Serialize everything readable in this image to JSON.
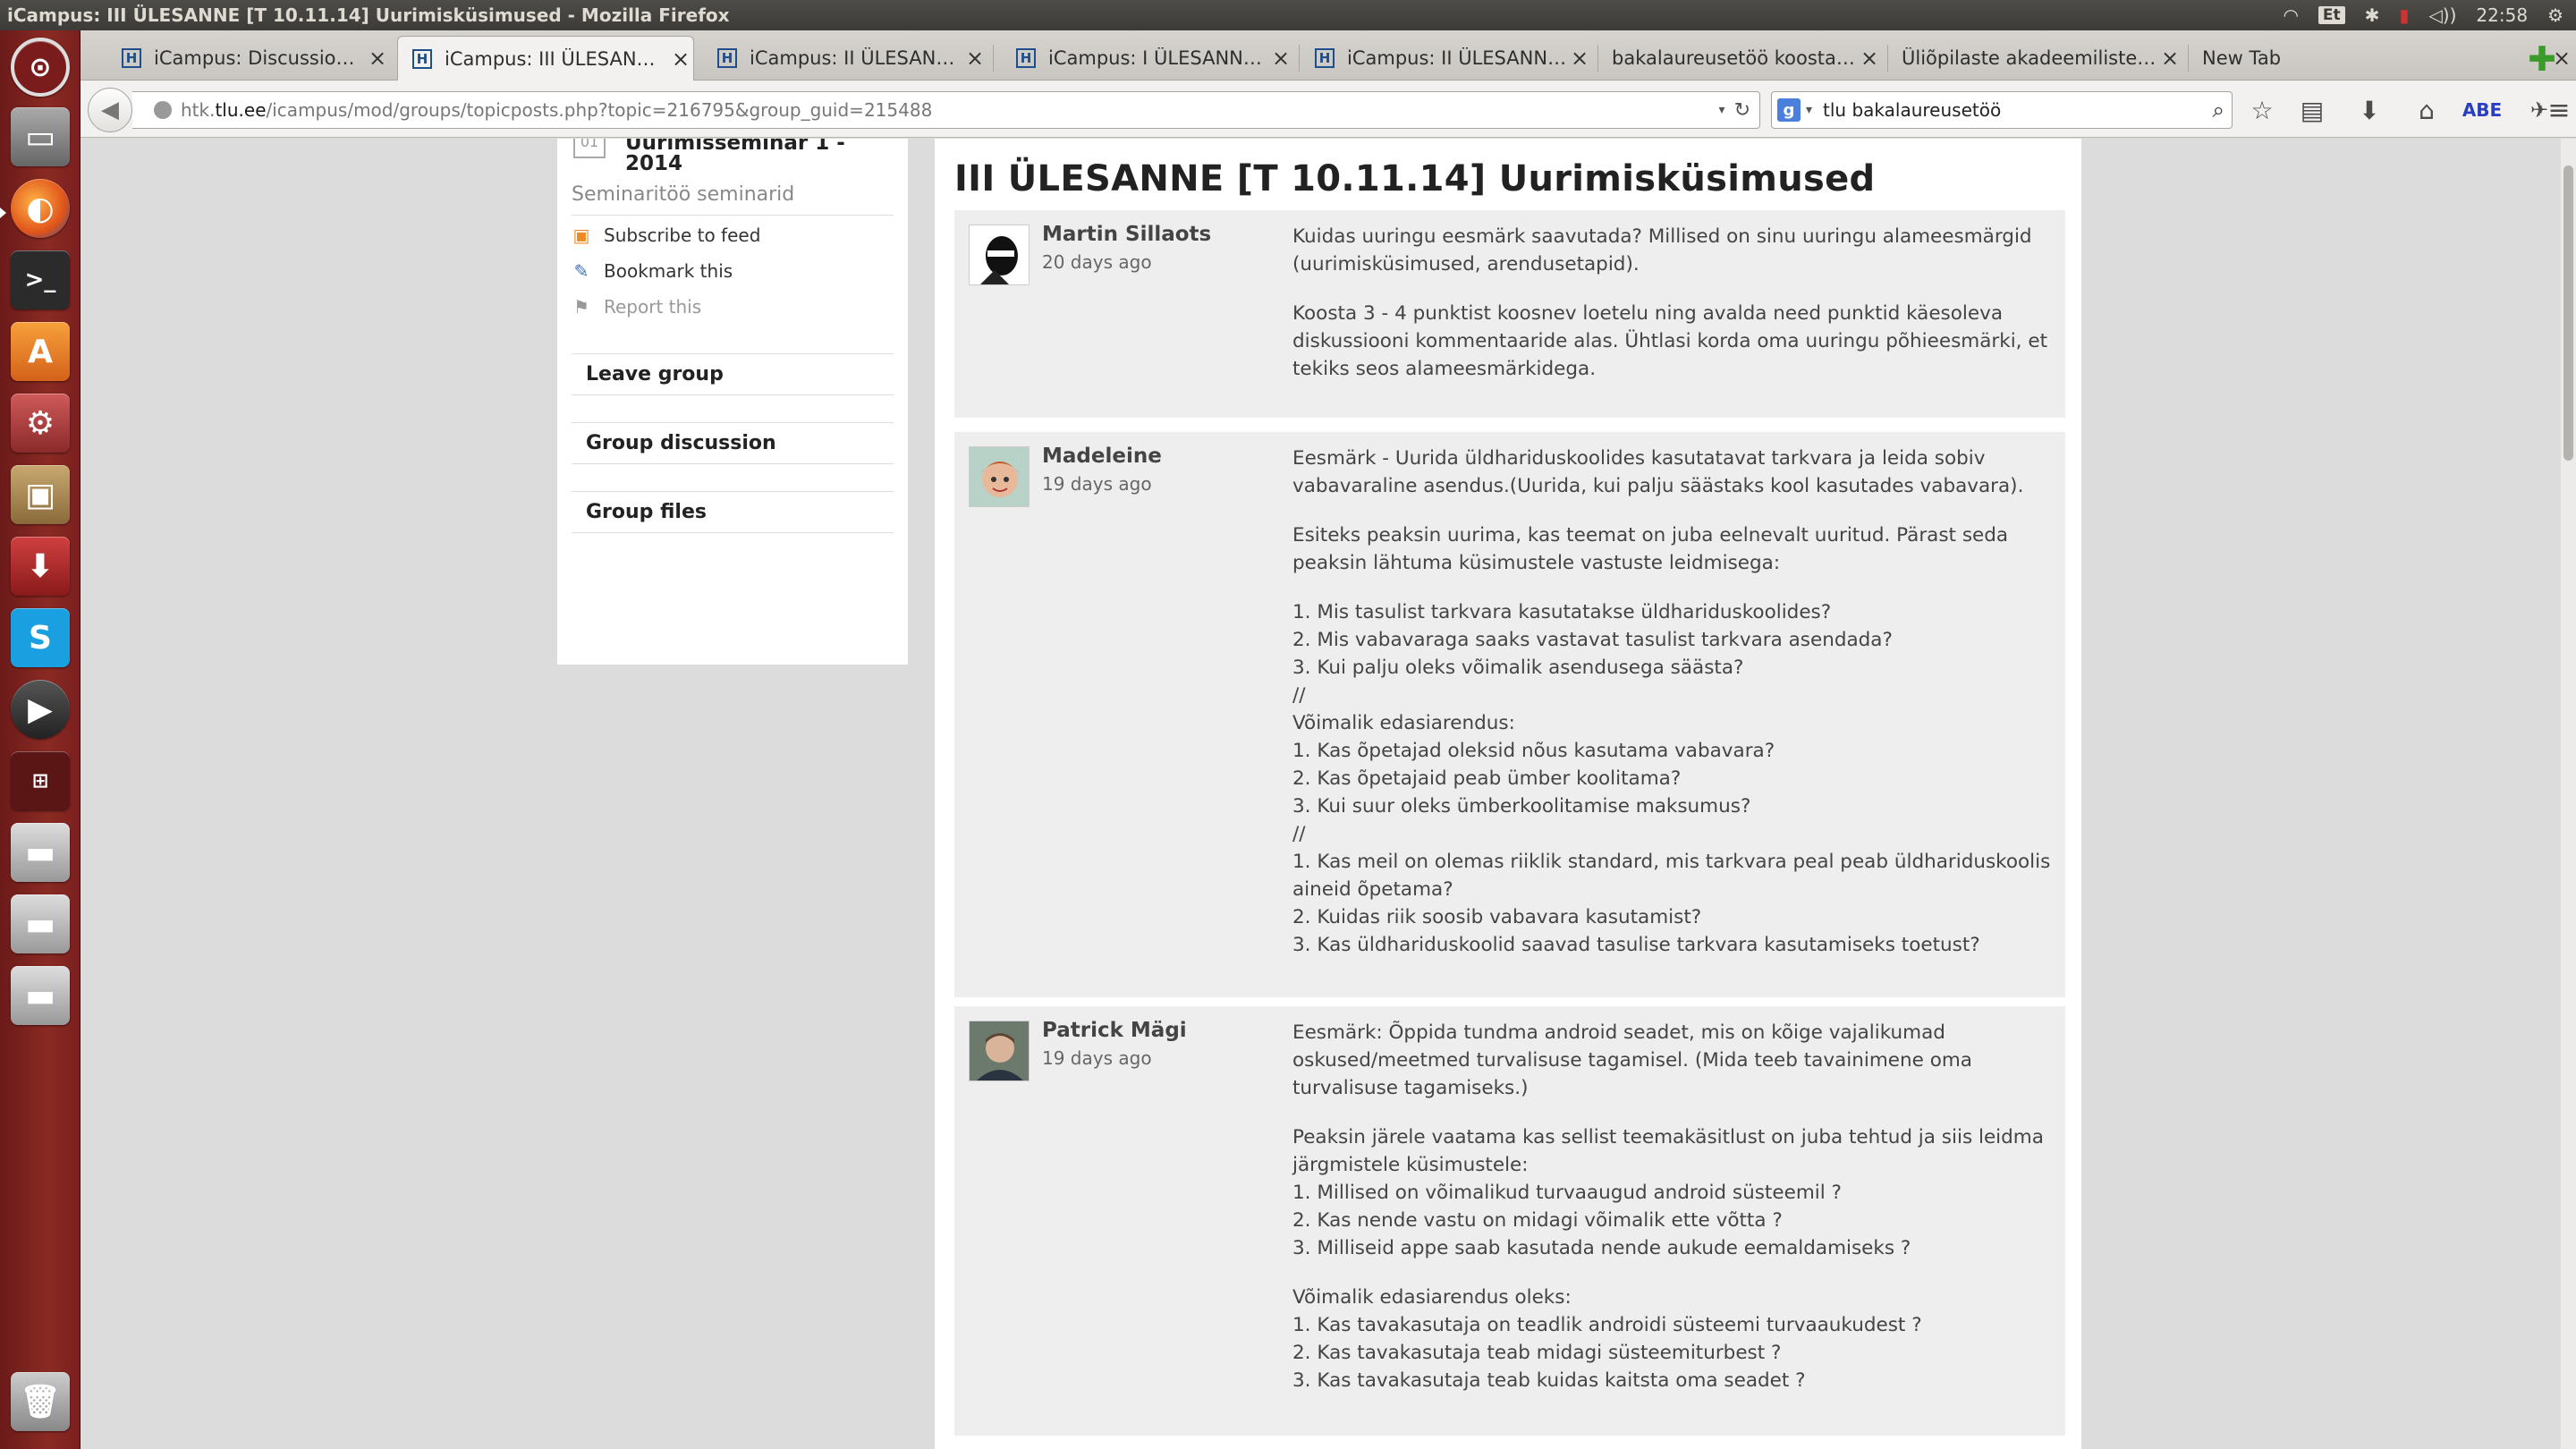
{
  "window": {
    "title": "iCampus: III ÜLESANNE [T 10.11.14] Uurimisküsimused - Mozilla Firefox",
    "keyboard_layout": "Et",
    "clock": "22:58"
  },
  "tabs": [
    {
      "label": "iCampus: Discussion to...",
      "favicon": "icampus-favicon",
      "active": false
    },
    {
      "label": "iCampus: III ÜLESANNE...",
      "favicon": "icampus-favicon",
      "active": true
    },
    {
      "label": "iCampus: II ÜLESANNE ...",
      "favicon": "icampus-favicon",
      "active": false
    },
    {
      "label": "iCampus: I ÜLESANNE [...",
      "favicon": "icampus-favicon",
      "active": false
    },
    {
      "label": "iCampus: II ÜLESANNE ...",
      "favicon": "icampus-favicon",
      "active": false
    },
    {
      "label": "bakalaureusetöö koostami...",
      "favicon": "",
      "active": false
    },
    {
      "label": "Üliõpilaste akadeemiliste t...",
      "favicon": "",
      "active": false
    },
    {
      "label": "New Tab",
      "favicon": "",
      "active": false
    }
  ],
  "address_bar": {
    "prefix": "htk.",
    "host": "tlu.ee",
    "path": "/icampus/mod/groups/topicposts.php?topic=216795&group_guid=215488"
  },
  "search_bar": {
    "value": "tlu bakalaureusetöö",
    "engine_letter": "g"
  },
  "sidebar": {
    "group_title": "Uurimisseminar 1 - 2014",
    "group_subtitle": "Seminaritöö seminarid",
    "links": {
      "subscribe": "Subscribe to feed",
      "bookmark": "Bookmark this",
      "report": "Report this"
    },
    "sections": {
      "leave": "Leave group",
      "discussion": "Group discussion",
      "files": "Group files"
    }
  },
  "topic": {
    "title": "III ÜLESANNE [T 10.11.14] Uurimisküsimused"
  },
  "posts": [
    {
      "author": "Martin Sillaots",
      "time": "20 days ago",
      "paragraphs": [
        "Kuidas uuringu eesmärk saavutada? Millised on sinu uuringu alameesmärgid (uurimisküsimused, arendusetapid).",
        "Koosta 3 - 4 punktist koosnev loetelu ning avalda need punktid käesoleva diskussiooni kommentaaride alas. Ühtlasi korda oma uuringu põhieesmärki, et tekiks seos alameesmärkidega."
      ]
    },
    {
      "author": "Madeleine",
      "time": "19 days ago",
      "paragraphs": [
        "Eesmärk - Uurida üldhariduskoolides kasutatavat tarkvara ja leida sobiv vabavaraline asendus.(Uurida, kui palju säästaks kool kasutades vabavara).",
        "Esiteks peaksin uurima, kas teemat on juba eelnevalt uuritud. Pärast seda peaksin lähtuma küsimustele vastuste leidmisega:",
        "1. Mis tasulist tarkvara kasutatakse üldhariduskoolides?\n2. Mis vabavaraga saaks vastavat tasulist tarkvara asendada?\n3. Kui palju oleks võimalik asendusega säästa?\n//\nVõimalik edasiarendus:\n1. Kas õpetajad oleksid nõus kasutama vabavara?\n2. Kas õpetajaid peab ümber koolitama?\n3. Kui suur oleks ümberkoolitamise maksumus?\n//\n1. Kas meil on olemas riiklik standard, mis tarkvara peal peab üldhariduskoolis aineid õpetama?\n2. Kuidas riik soosib vabavara kasutamist?\n3. Kas üldhariduskoolid saavad tasulise tarkvara kasutamiseks toetust?"
      ]
    },
    {
      "author": "Patrick Mägi",
      "time": "19 days ago",
      "paragraphs": [
        "Eesmärk: Õppida tundma android seadet, mis on kõige vajalikumad oskused/meetmed turvalisuse tagamisel. (Mida teeb tavainimene oma turvalisuse tagamiseks.)",
        "Peaksin järele vaatama kas sellist teemakäsitlust on juba tehtud ja siis leidma järgmistele küsimustele:\n1. Millised on võimalikud turvaaugud android süsteemil ?\n2. Kas nende vastu on midagi võimalik ette võtta ?\n3. Milliseid appe saab kasutada nende aukude eemaldamiseks ?",
        "Võimalik edasiarendus oleks:\n1. Kas tavakasutaja on teadlik androidi süsteemi turvaaukudest ?\n2. Kas tavakasutaja teab midagi süsteemiturbest ?\n3. Kas tavakasutaja teab kuidas kaitsta oma seadet ?"
      ]
    }
  ],
  "colors": {
    "launcher": "#7a2020",
    "panel": "#3c3b37",
    "post_bg": "#eeeeee"
  }
}
